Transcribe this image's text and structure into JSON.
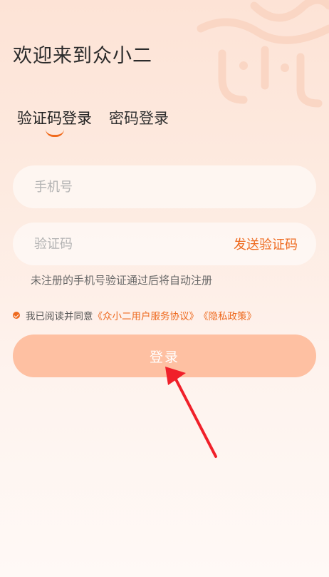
{
  "welcome_title": "欢迎来到众小二",
  "tabs": [
    {
      "label": "验证码登录",
      "active": true
    },
    {
      "label": "密码登录",
      "active": false
    }
  ],
  "phone_field": {
    "placeholder": "手机号"
  },
  "code_field": {
    "placeholder": "验证码",
    "send_label": "发送验证码"
  },
  "hint": "未注册的手机号验证通过后将自动注册",
  "agreement": {
    "prefix": "我已阅读并同意",
    "service_link": "《众小二用户服务协议》",
    "privacy_link": "《隐私政策》",
    "checked": true
  },
  "login_label": "登录",
  "colors": {
    "accent": "#ee6a1f",
    "button": "#fec0a2",
    "arrow": "#f0202a"
  }
}
